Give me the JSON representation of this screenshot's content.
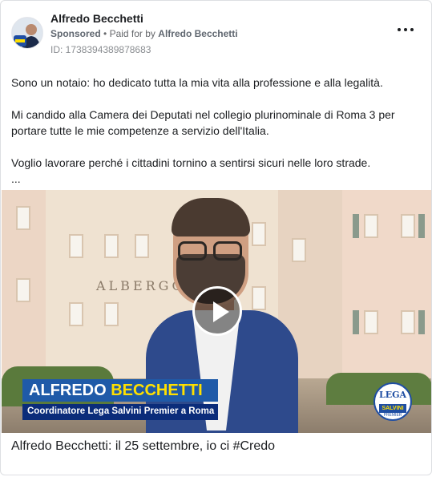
{
  "post": {
    "page_name": "Alfredo Becchetti",
    "sponsored_label": "Sponsored",
    "separator": "•",
    "paid_for_label": "Paid for by",
    "paid_by": "Alfredo Becchetti",
    "id_label": "ID: 1738394389878683",
    "more_icon": "more-horizontal-icon",
    "body": {
      "line1": "Sono un notaio: ho dedicato tutta la mia vita alla professione e alla legalità.",
      "line2": "Mi candido alla Camera dei Deputati nel collegio plurinominale di Roma 3 per portare tutte le mie competenze a servizio dell'Italia.",
      "line3": "Voglio lavorare perché i cittadini tornino a sentirsi sicuri nelle loro strade.",
      "ellipsis": "..."
    }
  },
  "video": {
    "sign_text": "ALBERGO",
    "banner_first": "ALFREDO",
    "banner_last": "BECCHETTI",
    "banner_subtitle": "Coordinatore Lega Salvini Premier a Roma",
    "logo_top": "LEGA",
    "logo_mid": "SALVINI",
    "logo_bottom": "PREMIER",
    "play_icon": "play-icon"
  },
  "caption": "Alfredo Becchetti: il 25 settembre, io ci #Credo",
  "colors": {
    "banner_blue": "#1f5aa8",
    "banner_dark": "#0b2c7a",
    "banner_yellow": "#ffe000",
    "text_secondary": "#65676b"
  }
}
